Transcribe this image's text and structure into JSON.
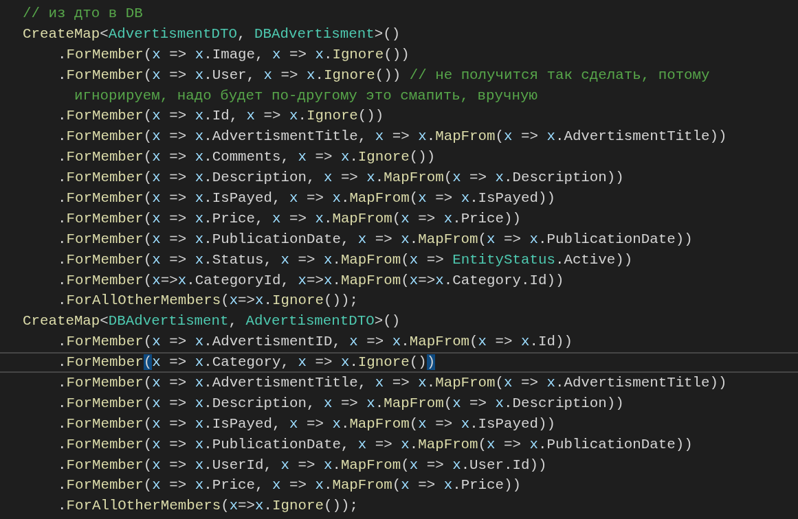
{
  "editor": {
    "lines": [
      {
        "kind": "top",
        "current": false,
        "tokens": [
          {
            "kind": "comment",
            "text": "// из дто в DB"
          }
        ]
      },
      {
        "kind": "top",
        "current": false,
        "tokens": [
          {
            "kind": "method",
            "text": "CreateMap"
          },
          {
            "kind": "plain",
            "text": "<"
          },
          {
            "kind": "type",
            "text": "AdvertismentDTO"
          },
          {
            "kind": "plain",
            "text": ", "
          },
          {
            "kind": "type",
            "text": "DBAdvertisment"
          },
          {
            "kind": "plain",
            "text": ">()"
          }
        ]
      },
      {
        "kind": "member",
        "current": false,
        "tokens": [
          {
            "kind": "plain",
            "text": "."
          },
          {
            "kind": "method",
            "text": "ForMember"
          },
          {
            "kind": "plain",
            "text": "("
          },
          {
            "kind": "param",
            "text": "x"
          },
          {
            "kind": "plain",
            "text": " => "
          },
          {
            "kind": "param",
            "text": "x"
          },
          {
            "kind": "plain",
            "text": ".Image, "
          },
          {
            "kind": "param",
            "text": "x"
          },
          {
            "kind": "plain",
            "text": " => "
          },
          {
            "kind": "param",
            "text": "x"
          },
          {
            "kind": "plain",
            "text": "."
          },
          {
            "kind": "method",
            "text": "Ignore"
          },
          {
            "kind": "plain",
            "text": "())"
          }
        ]
      },
      {
        "kind": "member",
        "current": false,
        "tokens": [
          {
            "kind": "plain",
            "text": "."
          },
          {
            "kind": "method",
            "text": "ForMember"
          },
          {
            "kind": "plain",
            "text": "("
          },
          {
            "kind": "param",
            "text": "x"
          },
          {
            "kind": "plain",
            "text": " => "
          },
          {
            "kind": "param",
            "text": "x"
          },
          {
            "kind": "plain",
            "text": ".User, "
          },
          {
            "kind": "param",
            "text": "x"
          },
          {
            "kind": "plain",
            "text": " => "
          },
          {
            "kind": "param",
            "text": "x"
          },
          {
            "kind": "plain",
            "text": "."
          },
          {
            "kind": "method",
            "text": "Ignore"
          },
          {
            "kind": "plain",
            "text": "()) "
          },
          {
            "kind": "comment",
            "text": "// не получится так сделать, потому"
          }
        ]
      },
      {
        "kind": "wrap",
        "current": false,
        "tokens": [
          {
            "kind": "comment",
            "text": "игнорируем, надо будет по-другому это смапить, вручную"
          }
        ]
      },
      {
        "kind": "member",
        "current": false,
        "tokens": [
          {
            "kind": "plain",
            "text": "."
          },
          {
            "kind": "method",
            "text": "ForMember"
          },
          {
            "kind": "plain",
            "text": "("
          },
          {
            "kind": "param",
            "text": "x"
          },
          {
            "kind": "plain",
            "text": " => "
          },
          {
            "kind": "param",
            "text": "x"
          },
          {
            "kind": "plain",
            "text": ".Id, "
          },
          {
            "kind": "param",
            "text": "x"
          },
          {
            "kind": "plain",
            "text": " => "
          },
          {
            "kind": "param",
            "text": "x"
          },
          {
            "kind": "plain",
            "text": "."
          },
          {
            "kind": "method",
            "text": "Ignore"
          },
          {
            "kind": "plain",
            "text": "())"
          }
        ]
      },
      {
        "kind": "member",
        "current": false,
        "tokens": [
          {
            "kind": "plain",
            "text": "."
          },
          {
            "kind": "method",
            "text": "ForMember"
          },
          {
            "kind": "plain",
            "text": "("
          },
          {
            "kind": "param",
            "text": "x"
          },
          {
            "kind": "plain",
            "text": " => "
          },
          {
            "kind": "param",
            "text": "x"
          },
          {
            "kind": "plain",
            "text": ".AdvertismentTitle, "
          },
          {
            "kind": "param",
            "text": "x"
          },
          {
            "kind": "plain",
            "text": " => "
          },
          {
            "kind": "param",
            "text": "x"
          },
          {
            "kind": "plain",
            "text": "."
          },
          {
            "kind": "method",
            "text": "MapFrom"
          },
          {
            "kind": "plain",
            "text": "("
          },
          {
            "kind": "param",
            "text": "x"
          },
          {
            "kind": "plain",
            "text": " => "
          },
          {
            "kind": "param",
            "text": "x"
          },
          {
            "kind": "plain",
            "text": ".AdvertismentTitle))"
          }
        ]
      },
      {
        "kind": "member",
        "current": false,
        "tokens": [
          {
            "kind": "plain",
            "text": "."
          },
          {
            "kind": "method",
            "text": "ForMember"
          },
          {
            "kind": "plain",
            "text": "("
          },
          {
            "kind": "param",
            "text": "x"
          },
          {
            "kind": "plain",
            "text": " => "
          },
          {
            "kind": "param",
            "text": "x"
          },
          {
            "kind": "plain",
            "text": ".Comments, "
          },
          {
            "kind": "param",
            "text": "x"
          },
          {
            "kind": "plain",
            "text": " => "
          },
          {
            "kind": "param",
            "text": "x"
          },
          {
            "kind": "plain",
            "text": "."
          },
          {
            "kind": "method",
            "text": "Ignore"
          },
          {
            "kind": "plain",
            "text": "())"
          }
        ]
      },
      {
        "kind": "member",
        "current": false,
        "tokens": [
          {
            "kind": "plain",
            "text": "."
          },
          {
            "kind": "method",
            "text": "ForMember"
          },
          {
            "kind": "plain",
            "text": "("
          },
          {
            "kind": "param",
            "text": "x"
          },
          {
            "kind": "plain",
            "text": " => "
          },
          {
            "kind": "param",
            "text": "x"
          },
          {
            "kind": "plain",
            "text": ".Description, "
          },
          {
            "kind": "param",
            "text": "x"
          },
          {
            "kind": "plain",
            "text": " => "
          },
          {
            "kind": "param",
            "text": "x"
          },
          {
            "kind": "plain",
            "text": "."
          },
          {
            "kind": "method",
            "text": "MapFrom"
          },
          {
            "kind": "plain",
            "text": "("
          },
          {
            "kind": "param",
            "text": "x"
          },
          {
            "kind": "plain",
            "text": " => "
          },
          {
            "kind": "param",
            "text": "x"
          },
          {
            "kind": "plain",
            "text": ".Description))"
          }
        ]
      },
      {
        "kind": "member",
        "current": false,
        "tokens": [
          {
            "kind": "plain",
            "text": "."
          },
          {
            "kind": "method",
            "text": "ForMember"
          },
          {
            "kind": "plain",
            "text": "("
          },
          {
            "kind": "param",
            "text": "x"
          },
          {
            "kind": "plain",
            "text": " => "
          },
          {
            "kind": "param",
            "text": "x"
          },
          {
            "kind": "plain",
            "text": ".IsPayed, "
          },
          {
            "kind": "param",
            "text": "x"
          },
          {
            "kind": "plain",
            "text": " => "
          },
          {
            "kind": "param",
            "text": "x"
          },
          {
            "kind": "plain",
            "text": "."
          },
          {
            "kind": "method",
            "text": "MapFrom"
          },
          {
            "kind": "plain",
            "text": "("
          },
          {
            "kind": "param",
            "text": "x"
          },
          {
            "kind": "plain",
            "text": " => "
          },
          {
            "kind": "param",
            "text": "x"
          },
          {
            "kind": "plain",
            "text": ".IsPayed))"
          }
        ]
      },
      {
        "kind": "member",
        "current": false,
        "tokens": [
          {
            "kind": "plain",
            "text": "."
          },
          {
            "kind": "method",
            "text": "ForMember"
          },
          {
            "kind": "plain",
            "text": "("
          },
          {
            "kind": "param",
            "text": "x"
          },
          {
            "kind": "plain",
            "text": " => "
          },
          {
            "kind": "param",
            "text": "x"
          },
          {
            "kind": "plain",
            "text": ".Price, "
          },
          {
            "kind": "param",
            "text": "x"
          },
          {
            "kind": "plain",
            "text": " => "
          },
          {
            "kind": "param",
            "text": "x"
          },
          {
            "kind": "plain",
            "text": "."
          },
          {
            "kind": "method",
            "text": "MapFrom"
          },
          {
            "kind": "plain",
            "text": "("
          },
          {
            "kind": "param",
            "text": "x"
          },
          {
            "kind": "plain",
            "text": " => "
          },
          {
            "kind": "param",
            "text": "x"
          },
          {
            "kind": "plain",
            "text": ".Price))"
          }
        ]
      },
      {
        "kind": "member",
        "current": false,
        "tokens": [
          {
            "kind": "plain",
            "text": "."
          },
          {
            "kind": "method",
            "text": "ForMember"
          },
          {
            "kind": "plain",
            "text": "("
          },
          {
            "kind": "param",
            "text": "x"
          },
          {
            "kind": "plain",
            "text": " => "
          },
          {
            "kind": "param",
            "text": "x"
          },
          {
            "kind": "plain",
            "text": ".PublicationDate, "
          },
          {
            "kind": "param",
            "text": "x"
          },
          {
            "kind": "plain",
            "text": " => "
          },
          {
            "kind": "param",
            "text": "x"
          },
          {
            "kind": "plain",
            "text": "."
          },
          {
            "kind": "method",
            "text": "MapFrom"
          },
          {
            "kind": "plain",
            "text": "("
          },
          {
            "kind": "param",
            "text": "x"
          },
          {
            "kind": "plain",
            "text": " => "
          },
          {
            "kind": "param",
            "text": "x"
          },
          {
            "kind": "plain",
            "text": ".PublicationDate))"
          }
        ]
      },
      {
        "kind": "member",
        "current": false,
        "tokens": [
          {
            "kind": "plain",
            "text": "."
          },
          {
            "kind": "method",
            "text": "ForMember"
          },
          {
            "kind": "plain",
            "text": "("
          },
          {
            "kind": "param",
            "text": "x"
          },
          {
            "kind": "plain",
            "text": " => "
          },
          {
            "kind": "param",
            "text": "x"
          },
          {
            "kind": "plain",
            "text": ".Status, "
          },
          {
            "kind": "param",
            "text": "x"
          },
          {
            "kind": "plain",
            "text": " => "
          },
          {
            "kind": "param",
            "text": "x"
          },
          {
            "kind": "plain",
            "text": "."
          },
          {
            "kind": "method",
            "text": "MapFrom"
          },
          {
            "kind": "plain",
            "text": "("
          },
          {
            "kind": "param",
            "text": "x"
          },
          {
            "kind": "plain",
            "text": " => "
          },
          {
            "kind": "type",
            "text": "EntityStatus"
          },
          {
            "kind": "plain",
            "text": ".Active))"
          }
        ]
      },
      {
        "kind": "member",
        "current": false,
        "tokens": [
          {
            "kind": "plain",
            "text": "."
          },
          {
            "kind": "method",
            "text": "ForMember"
          },
          {
            "kind": "plain",
            "text": "("
          },
          {
            "kind": "param",
            "text": "x"
          },
          {
            "kind": "plain",
            "text": "=>"
          },
          {
            "kind": "param",
            "text": "x"
          },
          {
            "kind": "plain",
            "text": ".CategoryId, "
          },
          {
            "kind": "param",
            "text": "x"
          },
          {
            "kind": "plain",
            "text": "=>"
          },
          {
            "kind": "param",
            "text": "x"
          },
          {
            "kind": "plain",
            "text": "."
          },
          {
            "kind": "method",
            "text": "MapFrom"
          },
          {
            "kind": "plain",
            "text": "("
          },
          {
            "kind": "param",
            "text": "x"
          },
          {
            "kind": "plain",
            "text": "=>"
          },
          {
            "kind": "param",
            "text": "x"
          },
          {
            "kind": "plain",
            "text": ".Category.Id))"
          }
        ]
      },
      {
        "kind": "member",
        "current": false,
        "tokens": [
          {
            "kind": "plain",
            "text": "."
          },
          {
            "kind": "method",
            "text": "ForAllOtherMembers"
          },
          {
            "kind": "plain",
            "text": "("
          },
          {
            "kind": "param",
            "text": "x"
          },
          {
            "kind": "plain",
            "text": "=>"
          },
          {
            "kind": "param",
            "text": "x"
          },
          {
            "kind": "plain",
            "text": "."
          },
          {
            "kind": "method",
            "text": "Ignore"
          },
          {
            "kind": "plain",
            "text": "());"
          }
        ]
      },
      {
        "kind": "top",
        "current": false,
        "tokens": [
          {
            "kind": "method",
            "text": "CreateMap"
          },
          {
            "kind": "plain",
            "text": "<"
          },
          {
            "kind": "type",
            "text": "DBAdvertisment"
          },
          {
            "kind": "plain",
            "text": ", "
          },
          {
            "kind": "type",
            "text": "AdvertismentDTO"
          },
          {
            "kind": "plain",
            "text": ">()"
          }
        ]
      },
      {
        "kind": "member",
        "current": false,
        "tokens": [
          {
            "kind": "plain",
            "text": "."
          },
          {
            "kind": "method",
            "text": "ForMember"
          },
          {
            "kind": "plain",
            "text": "("
          },
          {
            "kind": "param",
            "text": "x"
          },
          {
            "kind": "plain",
            "text": " => "
          },
          {
            "kind": "param",
            "text": "x"
          },
          {
            "kind": "plain",
            "text": ".AdvertismentID, "
          },
          {
            "kind": "param",
            "text": "x"
          },
          {
            "kind": "plain",
            "text": " => "
          },
          {
            "kind": "param",
            "text": "x"
          },
          {
            "kind": "plain",
            "text": "."
          },
          {
            "kind": "method",
            "text": "MapFrom"
          },
          {
            "kind": "plain",
            "text": "("
          },
          {
            "kind": "param",
            "text": "x"
          },
          {
            "kind": "plain",
            "text": " => "
          },
          {
            "kind": "param",
            "text": "x"
          },
          {
            "kind": "plain",
            "text": ".Id))"
          }
        ]
      },
      {
        "kind": "member",
        "current": true,
        "tokens": [
          {
            "kind": "plain",
            "text": "."
          },
          {
            "kind": "method",
            "text": "ForMember"
          },
          {
            "kind": "bracket",
            "text": "("
          },
          {
            "kind": "param",
            "text": "x"
          },
          {
            "kind": "plain",
            "text": " => "
          },
          {
            "kind": "param",
            "text": "x"
          },
          {
            "kind": "plain",
            "text": ".Category, "
          },
          {
            "kind": "param",
            "text": "x"
          },
          {
            "kind": "plain",
            "text": " => "
          },
          {
            "kind": "param",
            "text": "x"
          },
          {
            "kind": "plain",
            "text": "."
          },
          {
            "kind": "method",
            "text": "Ignore"
          },
          {
            "kind": "plain",
            "text": "()"
          },
          {
            "kind": "bracket",
            "text": ")"
          }
        ]
      },
      {
        "kind": "member",
        "current": false,
        "tokens": [
          {
            "kind": "plain",
            "text": "."
          },
          {
            "kind": "method",
            "text": "ForMember"
          },
          {
            "kind": "plain",
            "text": "("
          },
          {
            "kind": "param",
            "text": "x"
          },
          {
            "kind": "plain",
            "text": " => "
          },
          {
            "kind": "param",
            "text": "x"
          },
          {
            "kind": "plain",
            "text": ".AdvertismentTitle, "
          },
          {
            "kind": "param",
            "text": "x"
          },
          {
            "kind": "plain",
            "text": " => "
          },
          {
            "kind": "param",
            "text": "x"
          },
          {
            "kind": "plain",
            "text": "."
          },
          {
            "kind": "method",
            "text": "MapFrom"
          },
          {
            "kind": "plain",
            "text": "("
          },
          {
            "kind": "param",
            "text": "x"
          },
          {
            "kind": "plain",
            "text": " => "
          },
          {
            "kind": "param",
            "text": "x"
          },
          {
            "kind": "plain",
            "text": ".AdvertismentTitle))"
          }
        ]
      },
      {
        "kind": "member",
        "current": false,
        "tokens": [
          {
            "kind": "plain",
            "text": "."
          },
          {
            "kind": "method",
            "text": "ForMember"
          },
          {
            "kind": "plain",
            "text": "("
          },
          {
            "kind": "param",
            "text": "x"
          },
          {
            "kind": "plain",
            "text": " => "
          },
          {
            "kind": "param",
            "text": "x"
          },
          {
            "kind": "plain",
            "text": ".Description, "
          },
          {
            "kind": "param",
            "text": "x"
          },
          {
            "kind": "plain",
            "text": " => "
          },
          {
            "kind": "param",
            "text": "x"
          },
          {
            "kind": "plain",
            "text": "."
          },
          {
            "kind": "method",
            "text": "MapFrom"
          },
          {
            "kind": "plain",
            "text": "("
          },
          {
            "kind": "param",
            "text": "x"
          },
          {
            "kind": "plain",
            "text": " => "
          },
          {
            "kind": "param",
            "text": "x"
          },
          {
            "kind": "plain",
            "text": ".Description))"
          }
        ]
      },
      {
        "kind": "member",
        "current": false,
        "tokens": [
          {
            "kind": "plain",
            "text": "."
          },
          {
            "kind": "method",
            "text": "ForMember"
          },
          {
            "kind": "plain",
            "text": "("
          },
          {
            "kind": "param",
            "text": "x"
          },
          {
            "kind": "plain",
            "text": " => "
          },
          {
            "kind": "param",
            "text": "x"
          },
          {
            "kind": "plain",
            "text": ".IsPayed, "
          },
          {
            "kind": "param",
            "text": "x"
          },
          {
            "kind": "plain",
            "text": " => "
          },
          {
            "kind": "param",
            "text": "x"
          },
          {
            "kind": "plain",
            "text": "."
          },
          {
            "kind": "method",
            "text": "MapFrom"
          },
          {
            "kind": "plain",
            "text": "("
          },
          {
            "kind": "param",
            "text": "x"
          },
          {
            "kind": "plain",
            "text": " => "
          },
          {
            "kind": "param",
            "text": "x"
          },
          {
            "kind": "plain",
            "text": ".IsPayed))"
          }
        ]
      },
      {
        "kind": "member",
        "current": false,
        "tokens": [
          {
            "kind": "plain",
            "text": "."
          },
          {
            "kind": "method",
            "text": "ForMember"
          },
          {
            "kind": "plain",
            "text": "("
          },
          {
            "kind": "param",
            "text": "x"
          },
          {
            "kind": "plain",
            "text": " => "
          },
          {
            "kind": "param",
            "text": "x"
          },
          {
            "kind": "plain",
            "text": ".PublicationDate, "
          },
          {
            "kind": "param",
            "text": "x"
          },
          {
            "kind": "plain",
            "text": " => "
          },
          {
            "kind": "param",
            "text": "x"
          },
          {
            "kind": "plain",
            "text": "."
          },
          {
            "kind": "method",
            "text": "MapFrom"
          },
          {
            "kind": "plain",
            "text": "("
          },
          {
            "kind": "param",
            "text": "x"
          },
          {
            "kind": "plain",
            "text": " => "
          },
          {
            "kind": "param",
            "text": "x"
          },
          {
            "kind": "plain",
            "text": ".PublicationDate))"
          }
        ]
      },
      {
        "kind": "member",
        "current": false,
        "tokens": [
          {
            "kind": "plain",
            "text": "."
          },
          {
            "kind": "method",
            "text": "ForMember"
          },
          {
            "kind": "plain",
            "text": "("
          },
          {
            "kind": "param",
            "text": "x"
          },
          {
            "kind": "plain",
            "text": " => "
          },
          {
            "kind": "param",
            "text": "x"
          },
          {
            "kind": "plain",
            "text": ".UserId, "
          },
          {
            "kind": "param",
            "text": "x"
          },
          {
            "kind": "plain",
            "text": " => "
          },
          {
            "kind": "param",
            "text": "x"
          },
          {
            "kind": "plain",
            "text": "."
          },
          {
            "kind": "method",
            "text": "MapFrom"
          },
          {
            "kind": "plain",
            "text": "("
          },
          {
            "kind": "param",
            "text": "x"
          },
          {
            "kind": "plain",
            "text": " => "
          },
          {
            "kind": "param",
            "text": "x"
          },
          {
            "kind": "plain",
            "text": ".User.Id))"
          }
        ]
      },
      {
        "kind": "member",
        "current": false,
        "tokens": [
          {
            "kind": "plain",
            "text": "."
          },
          {
            "kind": "method",
            "text": "ForMember"
          },
          {
            "kind": "plain",
            "text": "("
          },
          {
            "kind": "param",
            "text": "x"
          },
          {
            "kind": "plain",
            "text": " => "
          },
          {
            "kind": "param",
            "text": "x"
          },
          {
            "kind": "plain",
            "text": ".Price, "
          },
          {
            "kind": "param",
            "text": "x"
          },
          {
            "kind": "plain",
            "text": " => "
          },
          {
            "kind": "param",
            "text": "x"
          },
          {
            "kind": "plain",
            "text": "."
          },
          {
            "kind": "method",
            "text": "MapFrom"
          },
          {
            "kind": "plain",
            "text": "("
          },
          {
            "kind": "param",
            "text": "x"
          },
          {
            "kind": "plain",
            "text": " => "
          },
          {
            "kind": "param",
            "text": "x"
          },
          {
            "kind": "plain",
            "text": ".Price))"
          }
        ]
      },
      {
        "kind": "member",
        "current": false,
        "tokens": [
          {
            "kind": "plain",
            "text": "."
          },
          {
            "kind": "method",
            "text": "ForAllOtherMembers"
          },
          {
            "kind": "plain",
            "text": "("
          },
          {
            "kind": "param",
            "text": "x"
          },
          {
            "kind": "plain",
            "text": "=>"
          },
          {
            "kind": "param",
            "text": "x"
          },
          {
            "kind": "plain",
            "text": "."
          },
          {
            "kind": "method",
            "text": "Ignore"
          },
          {
            "kind": "plain",
            "text": "());"
          }
        ]
      }
    ]
  }
}
